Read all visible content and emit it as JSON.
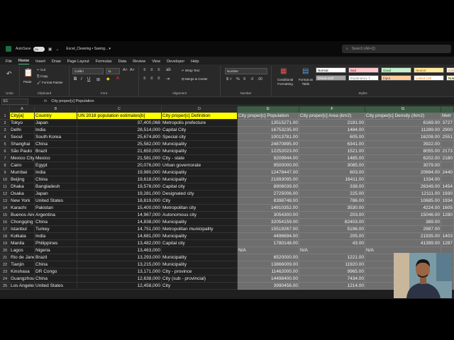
{
  "titlebar": {
    "autosave_label": "AutoSave",
    "autosave_state": "On",
    "document_title": "Excel_Cleaning • Saving...  ▾",
    "search_placeholder": "Search (Alt+Q)"
  },
  "menu": [
    "File",
    "Home",
    "Insert",
    "Draw",
    "Page Layout",
    "Formulas",
    "Data",
    "Review",
    "View",
    "Developer",
    "Help"
  ],
  "ribbon": {
    "undo_label": "Undo",
    "paste_label": "Paste",
    "cut_label": "Cut",
    "copy_label": "Copy",
    "format_painter_label": "Format Painter",
    "clipboard_label": "Clipboard",
    "font_name": "Calibri",
    "font_size": "11",
    "font_label": "Font",
    "wrap_text_label": "Wrap Text",
    "merge_label": "Merge & Center",
    "alignment_label": "Alignment",
    "number_format": "Number",
    "number_label": "Number",
    "conditional_label": "Conditional Formatting",
    "format_table_label": "Format as Table",
    "styles_label": "Styles",
    "cell_styles": [
      {
        "label": "Normal",
        "bg": "#ffffff",
        "fg": "#000000"
      },
      {
        "label": "Bad",
        "bg": "#ffc7ce",
        "fg": "#9c0006"
      },
      {
        "label": "Good",
        "bg": "#c6efce",
        "fg": "#006100"
      },
      {
        "label": "Neutral",
        "bg": "#ffeb9c",
        "fg": "#9c5700"
      },
      {
        "label": "Calcula",
        "bg": "#f2f2f2",
        "fg": "#fa7d00"
      },
      {
        "label": "Check Cell",
        "bg": "#a5a5a5",
        "fg": "#ffffff"
      },
      {
        "label": "Explanatory T...",
        "bg": "#ffffff",
        "fg": "#7f7f7f"
      },
      {
        "label": "Input",
        "bg": "#ffcc99",
        "fg": "#3f3f76"
      },
      {
        "label": "Linked Cell",
        "bg": "#ffffff",
        "fg": "#fa7d00"
      },
      {
        "label": "Note",
        "bg": "#ffffcc",
        "fg": "#000000"
      }
    ]
  },
  "formula_bar": {
    "name_box": "E1",
    "fx": "fx",
    "formula": "City proper[c] Population"
  },
  "columns": [
    "A",
    "B",
    "C",
    "D",
    "E",
    "F",
    "G",
    ""
  ],
  "header_row": [
    "City[a]",
    "Country",
    "UN 2018 population estimates[b]",
    "City proper[c] Definition",
    "City proper[c] Population",
    "City proper[c] Area (km2)",
    "City proper[c] Density (/km2)",
    "Metr"
  ],
  "rows": [
    [
      "Tokyo",
      "Japan",
      "37,400,068",
      "Metropolis prefecture",
      "13515271.00",
      "2191.00",
      "6169.00",
      "3727"
    ],
    [
      "Delhi",
      "India",
      "28,514,000",
      "Capital City",
      "16753235.00",
      "1484.00",
      "11289.00",
      "2900"
    ],
    [
      "Seoul",
      "South Korea",
      "25,674,800",
      "Special city",
      "10013781.00",
      "605.00",
      "16208.00",
      "2551"
    ],
    [
      "Shanghai",
      "China",
      "25,582,000",
      "Municipality",
      "24870895.00",
      "6341.00",
      "3922.00",
      ""
    ],
    [
      "São Paulo",
      "Brazil",
      "21,650,000",
      "Municipality",
      "12252023.00",
      "1521.00",
      "8055.00",
      "2173"
    ],
    [
      "Mexico City",
      "Mexico",
      "21,581,000",
      "City -    state",
      "9209944.00",
      "1485.00",
      "6202.00",
      "2180"
    ],
    [
      "Cairo",
      "Egypt",
      "20,076,000",
      "Urban governorate",
      "9500000.00",
      "3085.00",
      "3079.00",
      ""
    ],
    [
      "Mumbai",
      "India",
      "19,980,000",
      "Municipality",
      "12478447.00",
      "603.00",
      "20694.00",
      "2440"
    ],
    [
      "Beijing",
      "China",
      "19,618,000",
      "Municipality",
      "21893095.00",
      "16411.00",
      "1334.00",
      ""
    ],
    [
      "Dhaka",
      "Bangladesh",
      "19,578,000",
      "Capital city",
      "8906039.00",
      "338.00",
      "26349.00",
      "1454"
    ],
    [
      "Osaka",
      "Japan",
      "19,281,000",
      "Designated city",
      "2725006.00",
      "225.00",
      "12111.00",
      "1930"
    ],
    [
      "New York",
      "United States",
      "18,819,000",
      "City",
      "8398748.00",
      "786.00",
      "10685.00",
      "1934"
    ],
    [
      "Karachi",
      "Pakistan",
      "15,400,000",
      "Metropolitan city",
      "14910352.00",
      "3530.00",
      "4224.00",
      "1605"
    ],
    [
      "Buenos Aires",
      "Argentina",
      "14,967,000",
      "Autonomous city",
      "3054300.00",
      "203.00",
      "15046.00",
      "1280"
    ],
    [
      "Chongqing",
      "China",
      "14,838,000",
      "Municipality",
      "32054159.00",
      "82403.00",
      "389.00",
      ""
    ],
    [
      "Istanbul",
      "Turkey",
      "14,751,000",
      "Metropolitan municipality",
      "15519267.00",
      "5196.00",
      "2987.00",
      ""
    ],
    [
      "Kolkata",
      "India",
      "14,681,000",
      "Municipality",
      "4496694.00",
      "205.00",
      "21935.00",
      "1403"
    ],
    [
      "Manila",
      "Philippines",
      "13,482,000",
      "Capital city",
      "1780148.00",
      "43.00",
      "41399.00",
      "1287"
    ],
    [
      "Lagos",
      "Nigeria",
      "13,463,000",
      "",
      "N/A",
      "N/A",
      "N/A",
      ""
    ],
    [
      "Rio de Janeiro",
      "Brazil",
      "13,293,000",
      "Municipality",
      "6520000.00",
      "1221.00",
      "",
      ""
    ],
    [
      "Tianjin",
      "China",
      "13,215,000",
      "Municipality",
      "13866009.00",
      "11920.00",
      "",
      ""
    ],
    [
      "Kinshasa",
      "DR Congo",
      "13,171,000",
      "City -    province",
      "11462000.00",
      "9965.00",
      "",
      ""
    ],
    [
      "Guangzhou",
      "China",
      "12,638,000",
      "City (sub -    provincial)",
      "14498400.00",
      "7434.00",
      "",
      ""
    ],
    [
      "Los Angeles",
      "United States",
      "12,458,000",
      "City",
      "3990456.00",
      "1214.00",
      "",
      ""
    ]
  ]
}
